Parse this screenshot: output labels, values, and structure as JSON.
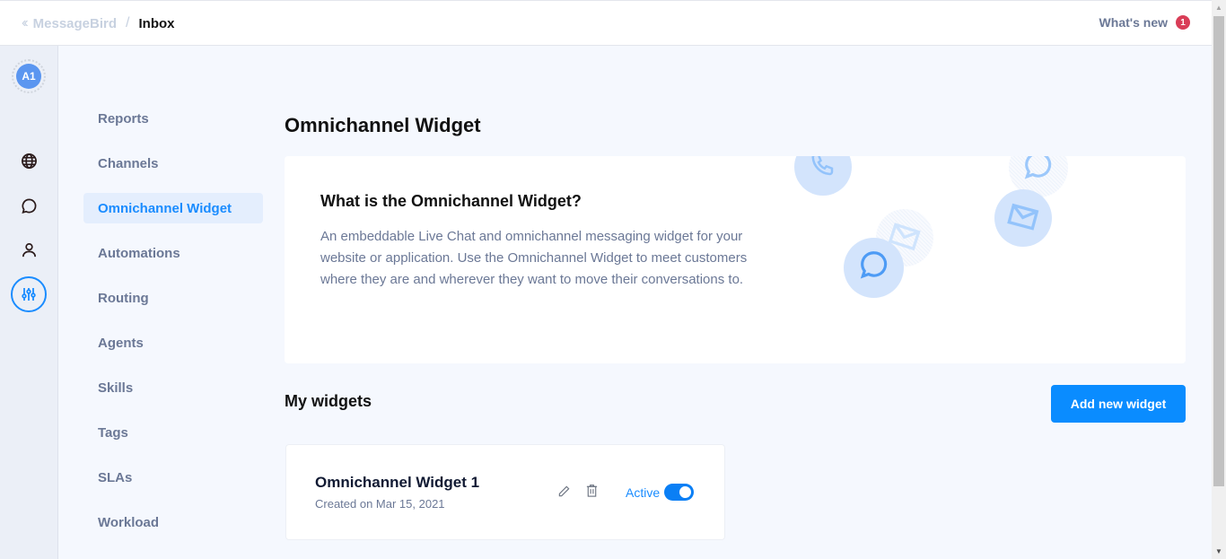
{
  "topbar": {
    "collapse_icon": "double-chevron-left-icon",
    "brand": "MessageBird",
    "separator": "/",
    "current": "Inbox",
    "whats_new_label": "What's new",
    "whats_new_count": "1"
  },
  "rail": {
    "avatar_initials": "A1",
    "icons": [
      "globe-icon",
      "chat-bubble-icon",
      "user-icon",
      "sliders-icon"
    ],
    "active_icon": "sliders-icon"
  },
  "subnav": {
    "items": [
      {
        "label": "Reports"
      },
      {
        "label": "Channels"
      },
      {
        "label": "Omnichannel Widget",
        "active": true
      },
      {
        "label": "Automations"
      },
      {
        "label": "Routing"
      },
      {
        "label": "Agents"
      },
      {
        "label": "Skills"
      },
      {
        "label": "Tags"
      },
      {
        "label": "SLAs"
      },
      {
        "label": "Workload"
      }
    ]
  },
  "main": {
    "title": "Omnichannel Widget",
    "intro": {
      "heading": "What is the Omnichannel Widget?",
      "text": "An embeddable Live Chat and omnichannel messaging widget for your website or application. Use the Omnichannel Widget to meet customers where they are and wherever they want to move their conversations to.",
      "illustration_icons": [
        "phone-icon",
        "chat-bubble-icon",
        "envelope-icon",
        "envelope-icon",
        "chat-bubble-icon"
      ]
    },
    "my_widgets": {
      "title": "My widgets",
      "add_button": "Add new widget",
      "widgets": [
        {
          "name": "Omnichannel Widget 1",
          "created": "Created on Mar 15, 2021",
          "status_label": "Active",
          "active": true
        }
      ]
    }
  },
  "colors": {
    "accent": "#0a8cff",
    "badge": "#d93d57",
    "muted_text": "#6b7896",
    "background": "#f5f8fe"
  }
}
